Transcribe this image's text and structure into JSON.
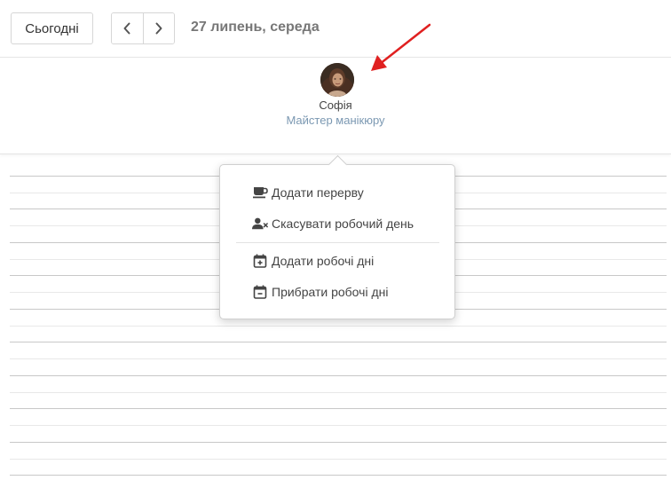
{
  "toolbar": {
    "today_label": "Сьогодні",
    "prev_icon": "chevron-left-icon",
    "next_icon": "chevron-right-icon",
    "date_title": "27 липень, середа"
  },
  "staff": {
    "name": "Софія",
    "role": "Майстер манікюру"
  },
  "menu": {
    "items": [
      {
        "label": "Додати перерву",
        "icon": "coffee-cup-icon"
      },
      {
        "label": "Скасувати робочий день",
        "icon": "user-remove-icon"
      },
      {
        "label": "Додати робочі дні",
        "icon": "calendar-plus-icon"
      },
      {
        "label": "Прибрати робочі дні",
        "icon": "calendar-minus-icon"
      }
    ]
  },
  "colors": {
    "role_text": "#7b98b2",
    "annotation_arrow": "#e02020",
    "title_text": "#777777"
  }
}
